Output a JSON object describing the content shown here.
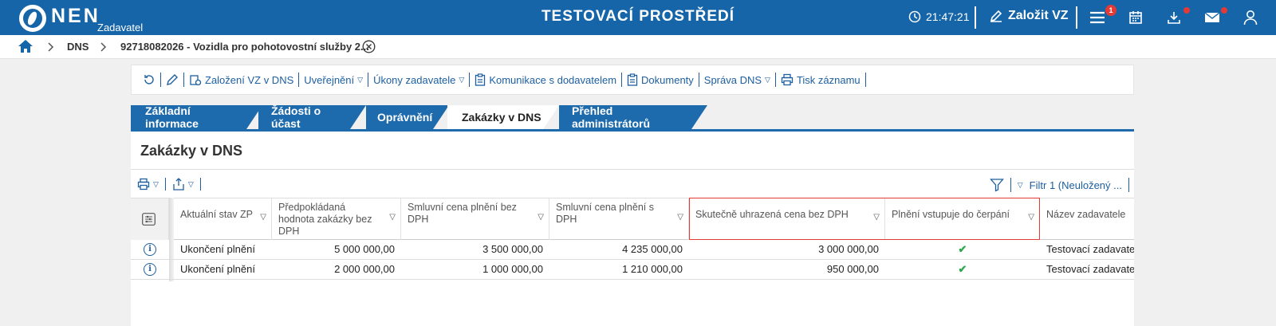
{
  "header": {
    "brand": "NEN",
    "brand_sub": "Zadavatel",
    "environment": "TESTOVACÍ PROSTŘEDÍ",
    "time": "21:47:21",
    "create_label": "Založit VZ",
    "menu_badge": "1"
  },
  "breadcrumb": {
    "item1": "DNS",
    "item2": "92718082026 - Vozidla pro pohotovostní služby 2..."
  },
  "toolbar": {
    "zalozeni": "Založení VZ v DNS",
    "uverejneni": "Uveřejnění",
    "ukony": "Úkony zadavatele",
    "komunikace": "Komunikace s dodavatelem",
    "dokumenty": "Dokumenty",
    "sprava": "Správa DNS",
    "tisk": "Tisk záznamu"
  },
  "tabs": [
    "Základní informace",
    "Žádosti o účast",
    "Oprávnění",
    "Zakázky v DNS",
    "Přehled administrátorů"
  ],
  "panel": {
    "title": "Zakázky v DNS",
    "filter_label": "Filtr 1 (Neuložený ..."
  },
  "table": {
    "columns": [
      "Aktuální stav ZP",
      "Předpokládaná hodnota zakázky bez DPH",
      "Smluvní cena plnění bez DPH",
      "Smluvní cena plnění s DPH",
      "Skutečně uhrazená cena bez DPH",
      "Plnění vstupuje do čerpání",
      "Název zadavatele"
    ],
    "rows": [
      [
        "Ukončení plnění",
        "5 000 000,00",
        "3 500 000,00",
        "4 235 000,00",
        "3 000 000,00",
        "✔",
        "Testovací zadavatel"
      ],
      [
        "Ukončení plnění",
        "2 000 000,00",
        "1 000 000,00",
        "1 210 000,00",
        "950 000,00",
        "✔",
        "Testovací zadavatel"
      ]
    ]
  }
}
